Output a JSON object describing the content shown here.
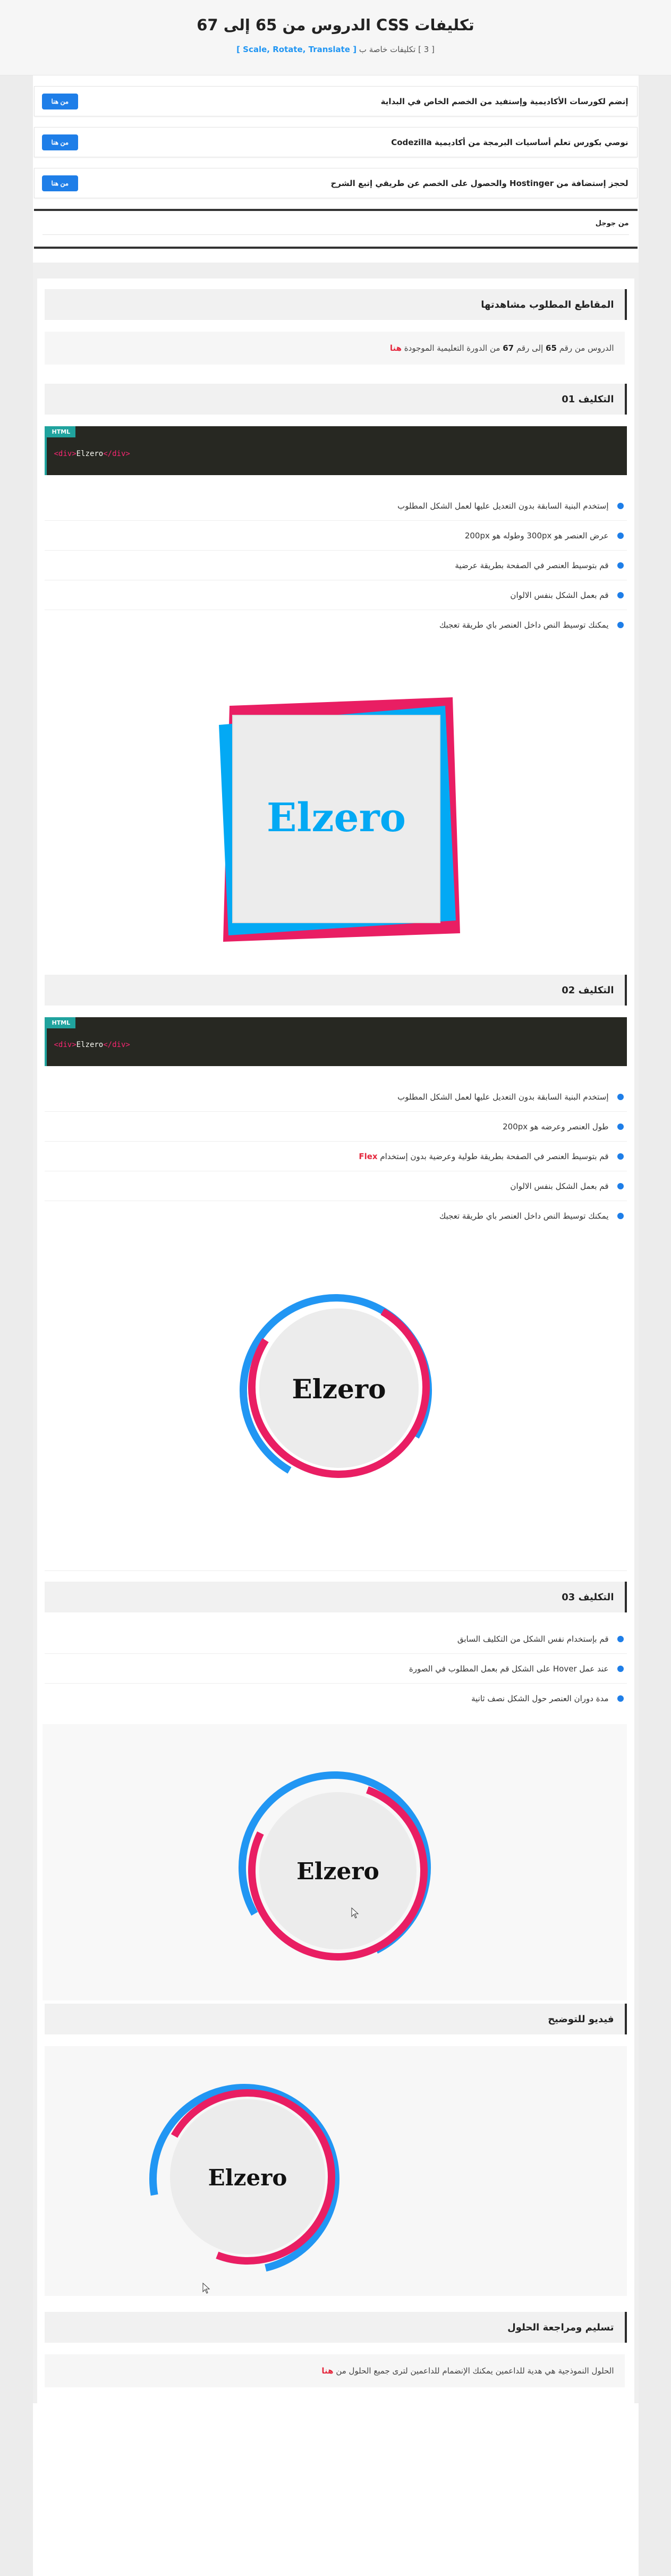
{
  "header": {
    "title": "تكليفات CSS الدروس من 65 إلى 67",
    "subtitle_prefix": "[ 3 ] تكليفات خاصة ب",
    "subtitle_topics": "[ Scale, Rotate, Translate ]"
  },
  "promos": [
    {
      "text": "إنضم لكورسات الأكاديمية وإستفيد من الخصم الخاص في البداية",
      "button": "من هنا"
    },
    {
      "text": "نوصي بكورس تعلم أساسيات البرمجة من أكاديمية Codezilla",
      "button": "من هنا"
    },
    {
      "text": "لحجز إستضافة من Hostinger والحصول على الخصم عن طريقي إتبع الشرح",
      "button": "من هنا"
    }
  ],
  "author": {
    "label": "من جوجل"
  },
  "required_videos": {
    "title": "المقاطع المطلوب مشاهدتها",
    "note_a": "الدروس من رقم ",
    "note_from": "65",
    "note_b": " إلى رقم ",
    "note_to": "67",
    "note_c": " من الدورة التعليمية الموجودة ",
    "note_link": "هنا"
  },
  "task1": {
    "title": "التكليف 01",
    "code_label": "HTML",
    "code_open": "<div>",
    "code_text": "Elzero",
    "code_close": "</div>",
    "items": [
      "إستخدم البنية السابقة بدون التعديل عليها لعمل الشكل المطلوب",
      "عرض العنصر هو 300px وطوله هو 200px",
      "قم بتوسيط العنصر في الصفحة بطريقة عرضية",
      "قم بعمل الشكل بنفس الالوان",
      "يمكنك توسيط النص داخل العنصر باي طريقة تعجبك"
    ],
    "preview_text": "Elzero"
  },
  "task2": {
    "title": "التكليف 02",
    "code_label": "HTML",
    "code_open": "<div>",
    "code_text": "Elzero",
    "code_close": "</div>",
    "items": [
      "إستخدم البنية السابقة بدون التعديل عليها لعمل الشكل المطلوب",
      "طول العنصر وعرضه هو 200px",
      "قم بتوسيط العنصر في الصفحة بطريقة طولية وعرضية بدون إستخدام",
      "قم بعمل الشكل بنفس الالوان",
      "يمكنك توسيط النص داخل العنصر باي طريقة تعجبك"
    ],
    "flex_word": "Flex",
    "preview_text": "Elzero"
  },
  "task3": {
    "title": "التكليف 03",
    "items": [
      "قم بإستخدام نفس الشكل من التكليف السابق",
      "عند عمل Hover على الشكل قم بعمل المطلوب في الصورة",
      "مدة دوران العنصر حول الشكل نصف ثانية"
    ],
    "preview_text": "Elzero"
  },
  "video": {
    "title": "فيديو للتوضيح",
    "preview_text": "Elzero"
  },
  "submit": {
    "title": "تسليم ومراجعة الحلول",
    "note": "الحلول النموذجية هي هدية للداعمين يمكنك الإنضمام للداعمين لترى جميع الحلول من ",
    "note_link": "هنا"
  },
  "colors": {
    "accent_blue": "#1e7ee8",
    "shape_blue": "#03a9f4",
    "shape_red": "#e91e63",
    "ring_blue": "#2196f3",
    "ring_red": "#e91e63",
    "code_bg": "#272822",
    "code_accent": "#20a39e"
  }
}
